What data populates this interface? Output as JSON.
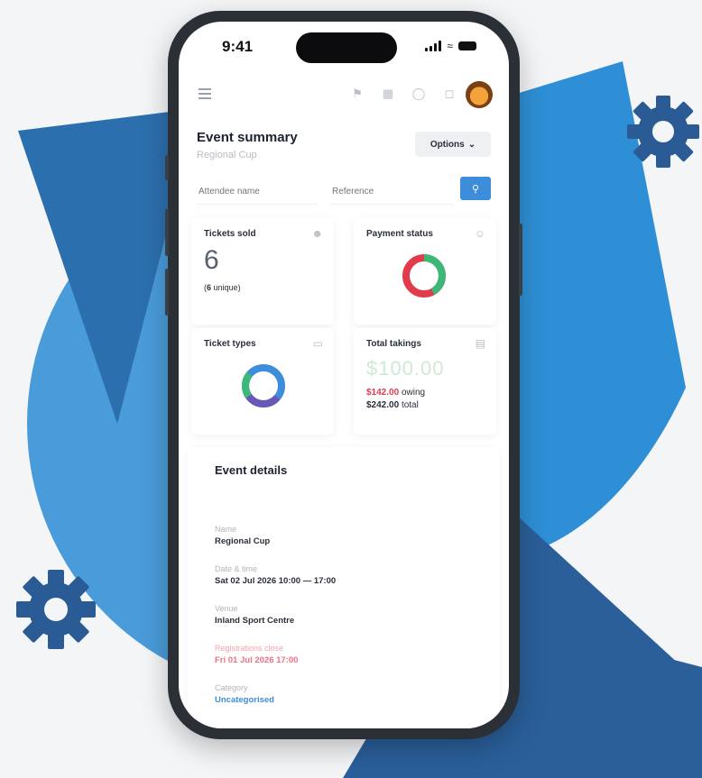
{
  "colors": {
    "bg_blue_light": "#3f93d6",
    "bg_blue_mid": "#2c79bf",
    "bg_blue_dark": "#24578f",
    "gear": "#2b5b94",
    "accent": "#3d8ddb",
    "red": "#e23b4b",
    "green": "#3cb878",
    "purple": "#6a57b5"
  },
  "status_bar": {
    "time": "9:41"
  },
  "app_bar": {
    "menu_icon": "hamburger-icon",
    "icons": [
      "megaphone-icon",
      "building-icon",
      "help-icon",
      "bell-icon"
    ],
    "avatar": "tiger-avatar"
  },
  "header": {
    "title": "Event summary",
    "subtitle": "Regional Cup",
    "options_label": "Options"
  },
  "search": {
    "attendee_placeholder": "Attendee name",
    "reference_placeholder": "Reference",
    "button_icon": "search-icon"
  },
  "cards": {
    "tickets_sold": {
      "title": "Tickets sold",
      "count": "6",
      "unique_count": "6",
      "unique_text": "unique"
    },
    "payment_status": {
      "title": "Payment status",
      "paid_fraction": 0.42
    },
    "ticket_types": {
      "title": "Ticket types"
    },
    "total_takings": {
      "title": "Total takings",
      "amount": "$100.00",
      "owing_amount": "$142.00",
      "owing_text": "owing",
      "total_amount": "$242.00",
      "total_text": "total"
    }
  },
  "event_details": {
    "title": "Event details",
    "name_label": "Name",
    "name_value": "Regional Cup",
    "datetime_label": "Date & time",
    "datetime_value": "Sat 02 Jul 2026 10:00 — 17:00",
    "venue_label": "Venue",
    "venue_value": "Inland Sport Centre",
    "reg_label": "Registrations close",
    "reg_value": "Fri 01 Jul 2026 17:00",
    "category_label": "Category",
    "category_value": "Uncategorised"
  }
}
